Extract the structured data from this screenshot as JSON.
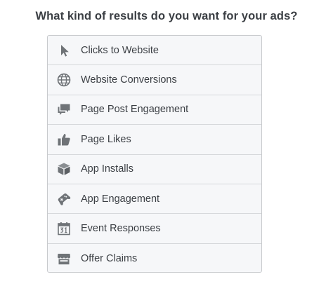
{
  "heading": "What kind of results do you want for your ads?",
  "icon_color": "#6f7377",
  "objectives": [
    {
      "label": "Clicks to Website",
      "icon": "cursor-icon"
    },
    {
      "label": "Website Conversions",
      "icon": "globe-icon"
    },
    {
      "label": "Page Post Engagement",
      "icon": "chat-bubbles-icon"
    },
    {
      "label": "Page Likes",
      "icon": "thumbs-up-icon"
    },
    {
      "label": "App Installs",
      "icon": "box-icon"
    },
    {
      "label": "App Engagement",
      "icon": "gamepad-icon"
    },
    {
      "label": "Event Responses",
      "icon": "calendar-icon"
    },
    {
      "label": "Offer Claims",
      "icon": "storefront-icon"
    }
  ]
}
